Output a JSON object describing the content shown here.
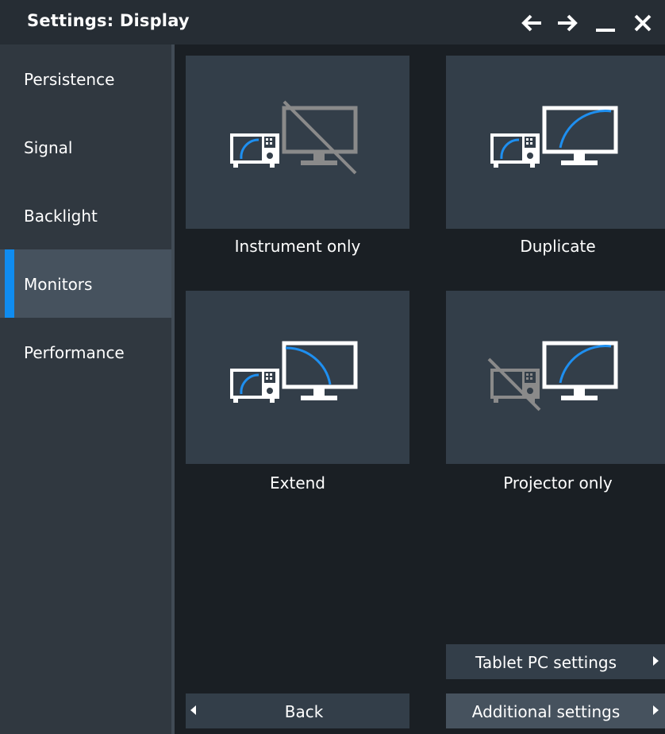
{
  "window": {
    "title": "Settings: Display",
    "controls": [
      "back-arrow-icon",
      "forward-arrow-icon",
      "minimize-icon",
      "close-icon"
    ]
  },
  "sidebar": {
    "items": [
      {
        "label": "Persistence",
        "selected": false
      },
      {
        "label": "Signal",
        "selected": false
      },
      {
        "label": "Backlight",
        "selected": false
      },
      {
        "label": "Monitors",
        "selected": true
      },
      {
        "label": "Performance",
        "selected": false
      }
    ]
  },
  "monitor_modes": [
    {
      "label": "Instrument only",
      "icon": "instrument-only-icon"
    },
    {
      "label": "Duplicate",
      "icon": "duplicate-icon"
    },
    {
      "label": "Extend",
      "icon": "extend-icon"
    },
    {
      "label": "Projector only",
      "icon": "projector-only-icon"
    }
  ],
  "buttons": {
    "tablet_pc": "Tablet PC settings",
    "back": "Back",
    "additional": "Additional settings"
  },
  "colors": {
    "accent": "#0f8cf0",
    "tile": "#333e49",
    "sidebar": "#303840",
    "selected": "#46525e"
  }
}
